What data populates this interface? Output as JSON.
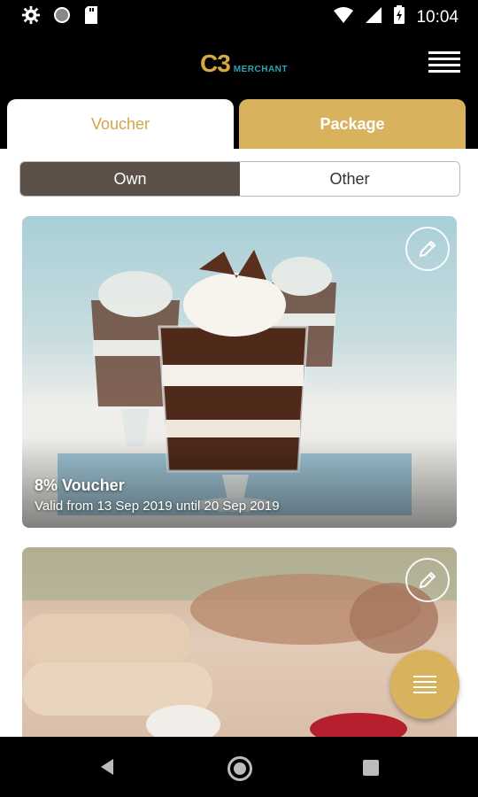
{
  "status_bar": {
    "time": "10:04",
    "icons": [
      "gear-icon",
      "circle-icon",
      "sd-card-icon",
      "wifi-icon",
      "signal-icon",
      "battery-icon"
    ]
  },
  "app_bar": {
    "logo_main": "C3",
    "logo_sub": "MERCHANT",
    "menu_icon": "hamburger-menu-icon"
  },
  "tabs": [
    {
      "label": "Voucher",
      "active": true
    },
    {
      "label": "Package",
      "active": false
    }
  ],
  "segment": {
    "own_label": "Own",
    "other_label": "Other",
    "selected": "Own"
  },
  "cards": [
    {
      "title": "8% Voucher",
      "valid_text": "Valid from 13 Sep 2019 until 20 Sep 2019",
      "image": "chocolate-parfait-dessert",
      "edit_icon": "pencil-icon"
    },
    {
      "title": "",
      "valid_text": "",
      "image": "spa-massage",
      "edit_icon": "pencil-icon"
    }
  ],
  "fab": {
    "icon": "list-icon"
  },
  "nav_bar": {
    "icons": [
      "back-icon",
      "home-icon",
      "recents-icon"
    ]
  },
  "colors": {
    "gold": "#d9b25e",
    "gold_text": "#d4a54a",
    "segment_selected": "#5a5048",
    "logo_teal": "#2aa3b7"
  }
}
